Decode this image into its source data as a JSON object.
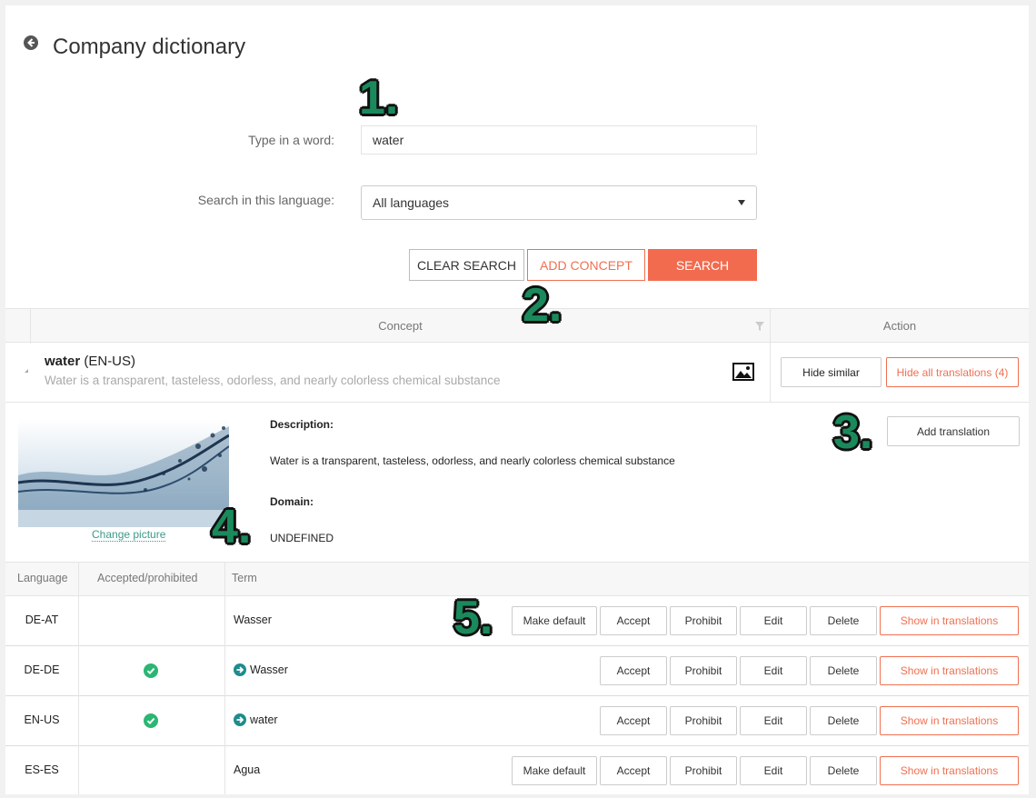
{
  "header": {
    "title": "Company dictionary"
  },
  "search": {
    "word_label": "Type in a word:",
    "word_value": "water",
    "language_label": "Search in this language:",
    "language_value": "All languages",
    "clear_label": "CLEAR SEARCH",
    "add_concept_label": "ADD CONCEPT",
    "search_label": "SEARCH"
  },
  "annotations": [
    "1.",
    "2.",
    "3.",
    "4.",
    "5."
  ],
  "concept_table": {
    "col_concept": "Concept",
    "col_action": "Action",
    "row": {
      "term": "water",
      "lang": "(EN-US)",
      "description": "Water is a transparent, tasteless, odorless, and nearly colorless chemical substance",
      "hide_similar": "Hide similar",
      "hide_translations": "Hide all translations (4)"
    }
  },
  "details": {
    "change_picture": "Change picture",
    "description_label": "Description:",
    "description_text": "Water is a transparent, tasteless, odorless, and nearly colorless chemical substance",
    "domain_label": "Domain:",
    "domain_value": "UNDEFINED",
    "add_translation": "Add translation"
  },
  "terms": {
    "col_language": "Language",
    "col_accepted": "Accepted/prohibited",
    "col_term": "Term",
    "rows": [
      {
        "lang": "DE-AT",
        "term": "Wasser",
        "accepted": false,
        "default": false
      },
      {
        "lang": "DE-DE",
        "term": "Wasser",
        "accepted": true,
        "default": true
      },
      {
        "lang": "EN-US",
        "term": "water",
        "accepted": true,
        "default": true
      },
      {
        "lang": "ES-ES",
        "term": "Agua",
        "accepted": false,
        "default": false
      }
    ],
    "actions": {
      "make_default": "Make default",
      "accept": "Accept",
      "prohibit": "Prohibit",
      "edit": "Edit",
      "delete": "Delete",
      "show": "Show in translations"
    }
  },
  "colors": {
    "accent": "#f26b4f",
    "annotation": "#1a8a5c",
    "check": "#2bb673",
    "link": "#3b9a8a"
  }
}
